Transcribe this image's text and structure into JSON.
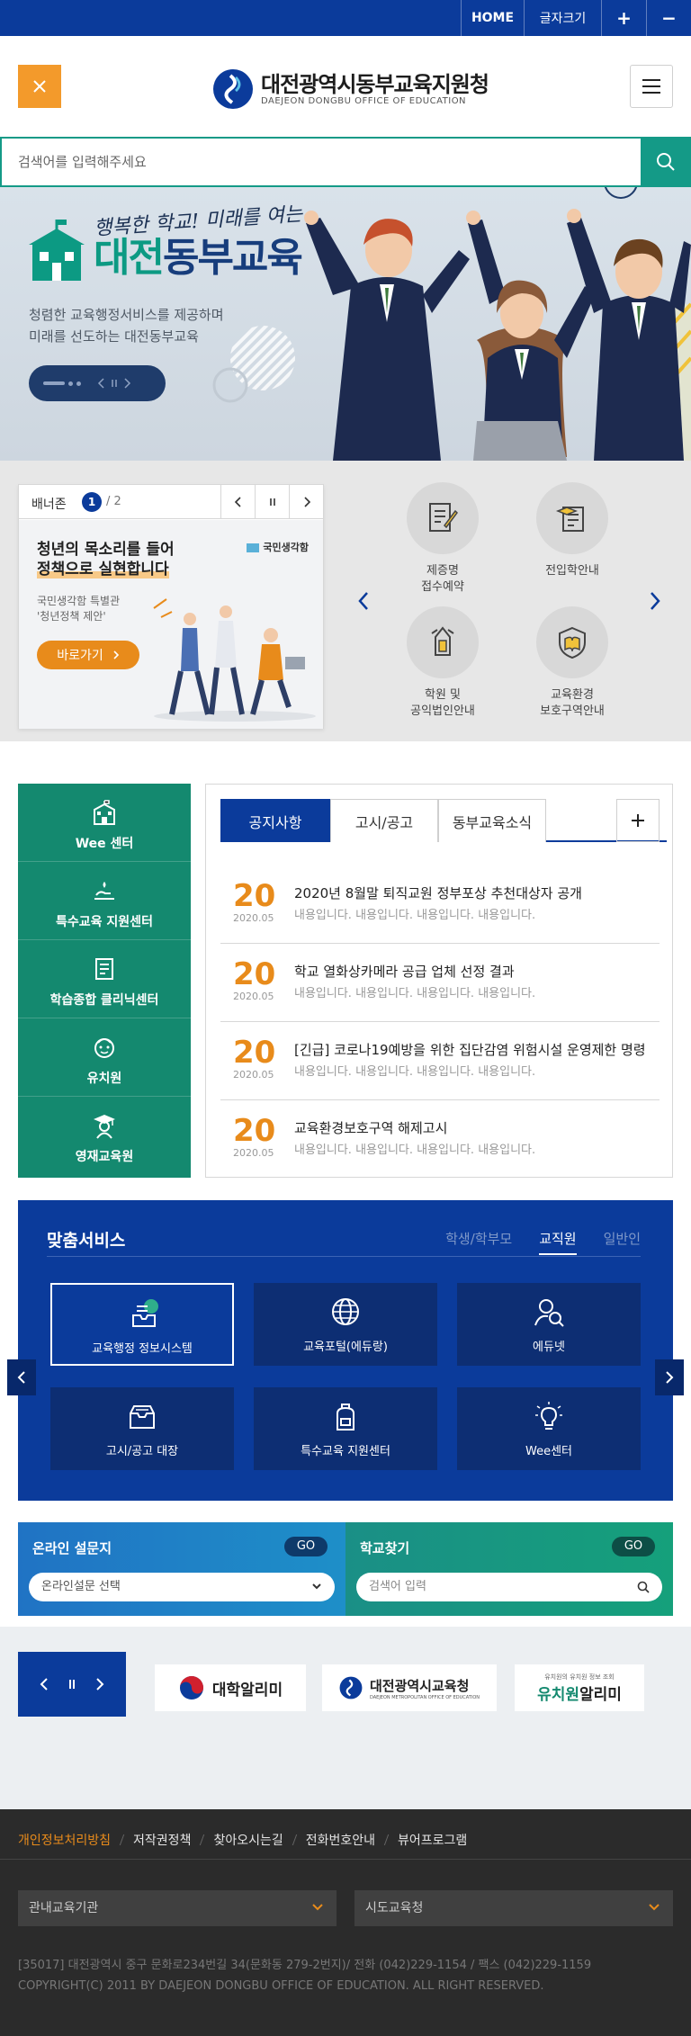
{
  "topbar": {
    "home": "HOME",
    "font_size": "글자크기",
    "plus": "+",
    "minus": "−"
  },
  "header": {
    "logo_title": "대전광역시동부교육지원청",
    "logo_subtitle": "DAEJEON DONGBU OFFICE OF EDUCATION"
  },
  "search": {
    "placeholder": "검색어를 입력해주세요"
  },
  "hero": {
    "slogan": "행복한 학교! 미래를 여는",
    "brand_part1": "대전",
    "brand_part2": "동부교육",
    "desc_line1": "청렴한 교육행정서비스를 제공하며",
    "desc_line2": "미래를 선도하는 대전동부교육"
  },
  "bannerzone": {
    "label": "배너존",
    "current": "1",
    "total": "/ 2",
    "heading_line1": "청년의 목소리를 들어",
    "heading_line2": "정책으로 실현합니다",
    "sub_line1": "국민생각함 특별관",
    "sub_line2": "'청년정책 제안'",
    "button": "바로가기",
    "badge": "국민생각함"
  },
  "quick_items": [
    {
      "line1": "제증명",
      "line2": "접수예약",
      "icon": "document-edit-icon"
    },
    {
      "line1": "전입학안내",
      "line2": "",
      "icon": "graduation-scroll-icon"
    },
    {
      "line1": "학원 및",
      "line2": "공익법인안내",
      "icon": "pencil-badge-icon"
    },
    {
      "line1": "교육환경",
      "line2": "보호구역안내",
      "icon": "shield-book-icon"
    }
  ],
  "sidebar": [
    {
      "label": "Wee 센터",
      "icon": "building-icon"
    },
    {
      "label": "특수교육 지원센터",
      "icon": "hand-heart-icon"
    },
    {
      "label": "학습종합 클리닉센터",
      "icon": "book-icon"
    },
    {
      "label": "유치원",
      "icon": "child-face-icon"
    },
    {
      "label": "영재교육원",
      "icon": "graduate-icon"
    }
  ],
  "notice": {
    "tabs": [
      "공지사항",
      "고시/공고",
      "동부교육소식"
    ],
    "items": [
      {
        "day": "20",
        "ym": "2020.05",
        "title": "2020년 8월말 퇴직교원 정부포상 추천대상자 공개",
        "content": "내용입니다. 내용입니다. 내용입니다. 내용입니다."
      },
      {
        "day": "20",
        "ym": "2020.05",
        "title": "학교 열화상카메라 공급 업체 선정 결과",
        "content": "내용입니다. 내용입니다. 내용입니다. 내용입니다."
      },
      {
        "day": "20",
        "ym": "2020.05",
        "title": "[긴급] 코로나19예방을 위한 집단감염 위험시설 운영제한 명령",
        "content": "내용입니다. 내용입니다. 내용입니다. 내용입니다."
      },
      {
        "day": "20",
        "ym": "2020.05",
        "title": "교육환경보호구역 해제고시",
        "content": "내용입니다. 내용입니다. 내용입니다. 내용입니다."
      }
    ]
  },
  "services": {
    "title": "맞춤서비스",
    "tabs": [
      "학생/학부모",
      "교직원",
      "일반인"
    ],
    "items": [
      {
        "label": "교육행정 정보시스템",
        "icon": "inbox-tray-icon"
      },
      {
        "label": "교육포털(에듀랑)",
        "icon": "globe-icon"
      },
      {
        "label": "에듀넷",
        "icon": "person-search-icon"
      },
      {
        "label": "고시/공고 대장",
        "icon": "archive-box-icon"
      },
      {
        "label": "특수교육 지원센터",
        "icon": "backpack-icon"
      },
      {
        "label": "Wee센터",
        "icon": "lightbulb-icon"
      }
    ]
  },
  "survey": {
    "title": "온라인 설문지",
    "go": "GO",
    "select": "온라인설문 선택"
  },
  "school": {
    "title": "학교찾기",
    "go": "GO",
    "placeholder": "검색어 입력"
  },
  "banner_links": [
    {
      "label": "대학알리미"
    },
    {
      "label": "대전광역시교육청",
      "sub": "DAEJEON METROPOLITAN OFFICE OF EDUCATION"
    },
    {
      "label_a": "유치원",
      "label_b": "알리미",
      "sub": "유치원의 유치원 정보 조회"
    }
  ],
  "footer": {
    "links": [
      "개인정보처리방침",
      "저작권정책",
      "찾아오시는길",
      "전화번호안내",
      "뷰어프로그램"
    ],
    "select1": "관내교육기관",
    "select2": "시도교육청",
    "address": "[35017] 대전광역시 중구 문화로234번길 34(문화동 279-2번지)/ 전화 (042)229-1154 / 팩스 (042)229-1159",
    "copyright": "COPYRIGHT(C) 2011 BY DAEJEON DONGBU OFFICE OF EDUCATION. ALL RIGHT RESERVED."
  },
  "colors": {
    "primary": "#0b3b9b",
    "accent": "#e88b1b",
    "teal": "#14896f",
    "search": "#149a87"
  }
}
